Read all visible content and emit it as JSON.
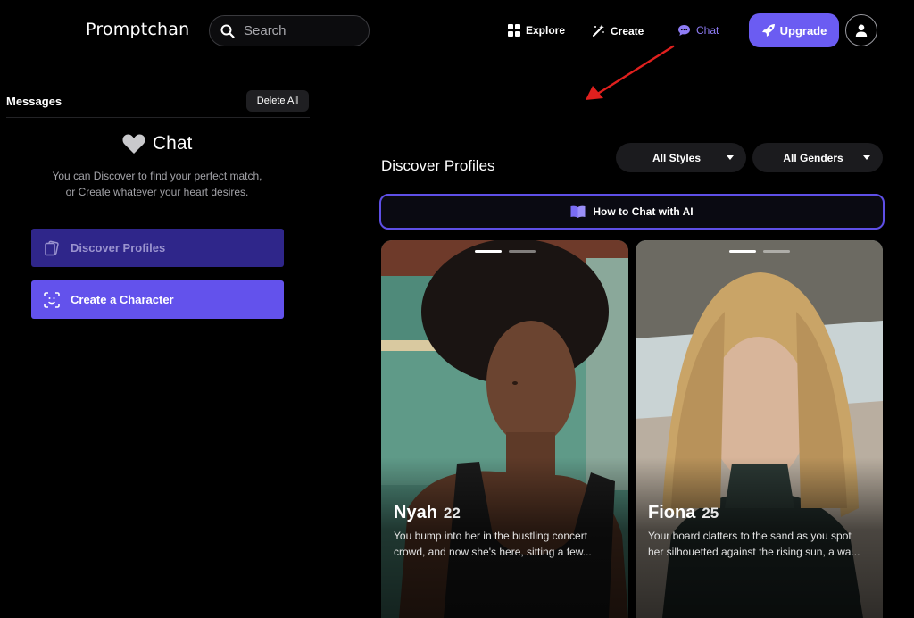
{
  "header": {
    "logo": "Promptchan",
    "search_placeholder": "Search",
    "nav": [
      {
        "label": "Explore",
        "icon": "grid-icon"
      },
      {
        "label": "Create",
        "icon": "magic-wand-icon"
      },
      {
        "label": "Chat",
        "icon": "chat-bubble-icon",
        "active": true
      }
    ],
    "upgrade_label": "Upgrade",
    "accent_color": "#6b5cf2"
  },
  "sidebar": {
    "title": "Messages",
    "delete_all_label": "Delete All",
    "chat_heading": "Chat",
    "chat_desc": "You can Discover to find your perfect match, or Create whatever your heart desires.",
    "discover_label": "Discover Profiles",
    "create_label": "Create a Character"
  },
  "main": {
    "title": "Discover Profiles",
    "filters": {
      "styles": "All Styles",
      "genders": "All Genders"
    },
    "howto_label": "How to Chat with AI",
    "profiles": [
      {
        "name": "Nyah",
        "age": "22",
        "desc": "You bump into her in the bustling concert crowd, and now she's here, sitting a few..."
      },
      {
        "name": "Fiona",
        "age": "25",
        "desc": "Your board clatters to the sand as you spot her silhouetted against the rising sun, a wa..."
      }
    ]
  }
}
